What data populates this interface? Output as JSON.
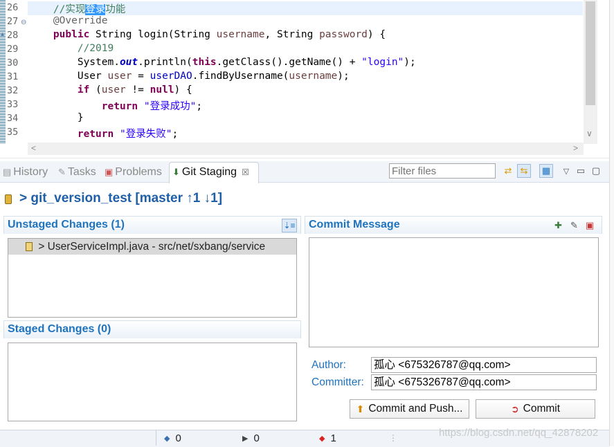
{
  "editor": {
    "lines": [
      {
        "n": "26",
        "parts": [
          {
            "t": "    //实现",
            "c": "cm"
          },
          {
            "t": "登录",
            "c": "sel"
          },
          {
            "t": "功能",
            "c": "cm"
          }
        ]
      },
      {
        "n": "27",
        "parts": [
          {
            "t": "    @Override",
            "c": "an"
          }
        ]
      },
      {
        "n": "28",
        "parts": [
          {
            "t": "    ",
            "c": ""
          },
          {
            "t": "public",
            "c": "kw"
          },
          {
            "t": " String login(String ",
            "c": ""
          },
          {
            "t": "username",
            "c": "va"
          },
          {
            "t": ", String ",
            "c": ""
          },
          {
            "t": "password",
            "c": "va"
          },
          {
            "t": ") {",
            "c": ""
          }
        ]
      },
      {
        "n": "29",
        "parts": [
          {
            "t": "        //2019",
            "c": "cm"
          }
        ]
      },
      {
        "n": "30",
        "parts": [
          {
            "t": "        System.",
            "c": ""
          },
          {
            "t": "out",
            "c": "fld"
          },
          {
            "t": ".println(",
            "c": ""
          },
          {
            "t": "this",
            "c": "kw"
          },
          {
            "t": ".getClass().getName() + ",
            "c": ""
          },
          {
            "t": "\"login\"",
            "c": "st"
          },
          {
            "t": ");",
            "c": ""
          }
        ]
      },
      {
        "n": "31",
        "parts": [
          {
            "t": "        User ",
            "c": ""
          },
          {
            "t": "user",
            "c": "va"
          },
          {
            "t": " = ",
            "c": ""
          },
          {
            "t": "userDAO",
            "c": "fl2"
          },
          {
            "t": ".findByUsername(",
            "c": ""
          },
          {
            "t": "username",
            "c": "va"
          },
          {
            "t": ");",
            "c": ""
          }
        ]
      },
      {
        "n": "32",
        "parts": [
          {
            "t": "        ",
            "c": ""
          },
          {
            "t": "if",
            "c": "kw"
          },
          {
            "t": " (",
            "c": ""
          },
          {
            "t": "user",
            "c": "va"
          },
          {
            "t": " != ",
            "c": ""
          },
          {
            "t": "null",
            "c": "kw"
          },
          {
            "t": ") {",
            "c": ""
          }
        ]
      },
      {
        "n": "33",
        "parts": [
          {
            "t": "            ",
            "c": ""
          },
          {
            "t": "return",
            "c": "kw"
          },
          {
            "t": " ",
            "c": ""
          },
          {
            "t": "\"登录成功\"",
            "c": "st"
          },
          {
            "t": ";",
            "c": ""
          }
        ]
      },
      {
        "n": "34",
        "parts": [
          {
            "t": "        }",
            "c": ""
          }
        ]
      },
      {
        "n": "35",
        "parts": [
          {
            "t": "        ",
            "c": ""
          },
          {
            "t": "return",
            "c": "kw"
          },
          {
            "t": " ",
            "c": ""
          },
          {
            "t": "\"登录失败\"",
            "c": "st"
          },
          {
            "t": ";",
            "c": ""
          }
        ]
      }
    ]
  },
  "tabs": {
    "history": "History",
    "tasks": "Tasks",
    "problems": "Problems",
    "git_staging": "Git Staging",
    "close": "☒"
  },
  "filter": {
    "placeholder": "Filter files"
  },
  "repo": {
    "title": "> git_version_test [master ↑1 ↓1]"
  },
  "unstaged": {
    "title": "Unstaged Changes (1)",
    "files": [
      "> UserServiceImpl.java - src/net/sxbang/service"
    ]
  },
  "staged": {
    "title": "Staged Changes (0)"
  },
  "commit": {
    "title": "Commit Message",
    "author_label": "Author:",
    "author_value": "孤心 <675326787@qq.com>",
    "committer_label": "Committer:",
    "committer_value": "孤心 <675326787@qq.com>",
    "commit_push_label": "Commit and Push...",
    "commit_label": "Commit"
  },
  "status": {
    "incoming": "0",
    "outgoing": "0",
    "conflicts": "1"
  },
  "watermark": "https://blog.csdn.net/qq_42878202",
  "colors": {
    "accent": "#1e73be",
    "keyword": "#7f0055",
    "string": "#2a00ff",
    "comment": "#3f7f5f"
  }
}
